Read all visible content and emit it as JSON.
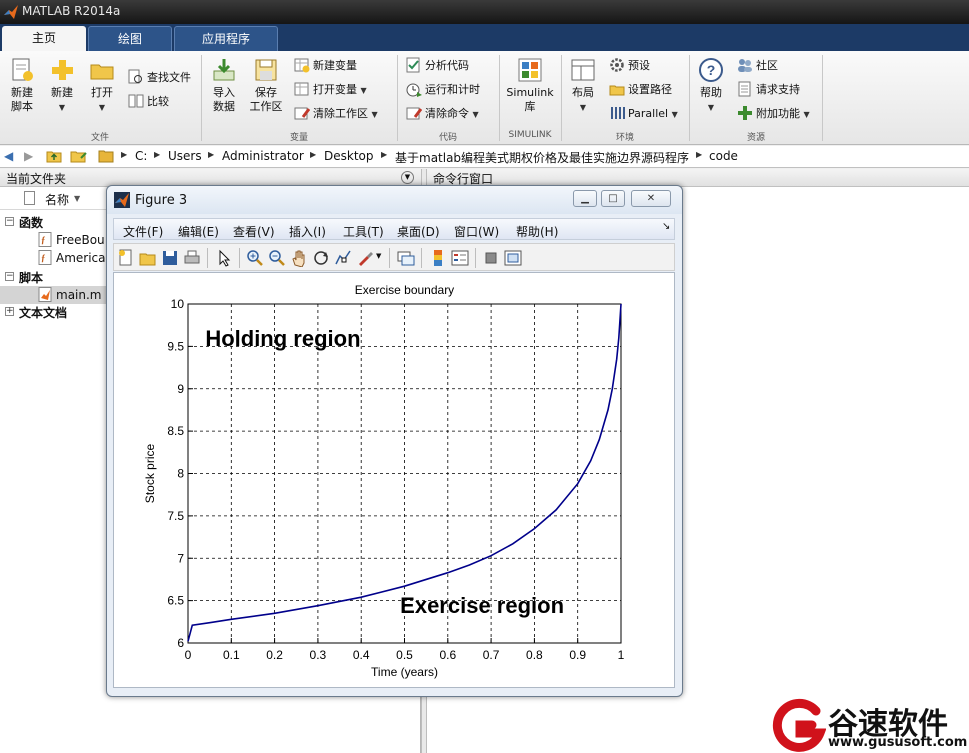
{
  "app": {
    "title": "MATLAB R2014a"
  },
  "tabs": [
    {
      "label": "主页",
      "active": true
    },
    {
      "label": "绘图",
      "active": false
    },
    {
      "label": "应用程序",
      "active": false
    }
  ],
  "ribbon": {
    "file_group": {
      "label": "文件",
      "new_script": "新建\n脚本",
      "new": "新建",
      "open": "打开",
      "find_files": "查找文件",
      "compare": "比较"
    },
    "variable_group": {
      "label": "变量",
      "import_data": "导入\n数据",
      "save_workspace": "保存\n工作区",
      "new_variable": "新建变量",
      "open_variable": "打开变量",
      "clear_workspace": "清除工作区"
    },
    "code_group": {
      "label": "代码",
      "analyze_code": "分析代码",
      "run_and_time": "运行和计时",
      "clear_commands": "清除命令"
    },
    "simulink_group": {
      "label": "SIMULINK",
      "simulink_library": "Simulink\n库"
    },
    "environment_group": {
      "label": "环境",
      "layout": "布局",
      "preferences": "预设",
      "set_path": "设置路径",
      "parallel": "Parallel"
    },
    "resources_group": {
      "label": "资源",
      "help": "帮助",
      "community": "社区",
      "request_support": "请求支持",
      "addons": "附加功能"
    }
  },
  "address": {
    "crumbs": [
      "C:",
      "Users",
      "Administrator",
      "Desktop",
      "基于matlab编程美式期权价格及最佳实施边界源码程序",
      "code"
    ]
  },
  "current_folder": {
    "title": "当前文件夹",
    "column_name": "名称",
    "groups": [
      {
        "label": "函数",
        "items": [
          "FreeBou",
          "Americar"
        ]
      },
      {
        "label": "脚本",
        "items": [
          "main.m"
        ]
      },
      {
        "label": "文本文档",
        "items": []
      }
    ]
  },
  "command_window": {
    "title": "命令行窗口"
  },
  "figure": {
    "title": "Figure 3",
    "menus": [
      "文件(F)",
      "编辑(E)",
      "查看(V)",
      "插入(I)",
      "工具(T)",
      "桌面(D)",
      "窗口(W)",
      "帮助(H)"
    ]
  },
  "chart_data": {
    "type": "line",
    "title": "Exercise boundary",
    "xlabel": "Time (years)",
    "ylabel": "Stock price",
    "xlim": [
      0,
      1
    ],
    "ylim": [
      6,
      10
    ],
    "xticks": [
      "0",
      "0.1",
      "0.2",
      "0.3",
      "0.4",
      "0.5",
      "0.6",
      "0.7",
      "0.8",
      "0.9",
      "1"
    ],
    "yticks": [
      "6",
      "6.5",
      "7",
      "7.5",
      "8",
      "8.5",
      "9",
      "9.5",
      "10"
    ],
    "grid": true,
    "annotations": [
      {
        "text": "Holding region",
        "x": 0.04,
        "y": 9.6
      },
      {
        "text": "Exercise region",
        "x": 0.49,
        "y": 6.45
      }
    ],
    "series": [
      {
        "color": "#00008b",
        "x": [
          0,
          0.01,
          0.05,
          0.1,
          0.2,
          0.3,
          0.4,
          0.5,
          0.6,
          0.65,
          0.7,
          0.75,
          0.8,
          0.85,
          0.9,
          0.93,
          0.95,
          0.97,
          0.98,
          0.99,
          0.995,
          1.0
        ],
        "y": [
          6.02,
          6.21,
          6.24,
          6.28,
          6.35,
          6.44,
          6.54,
          6.67,
          6.83,
          6.92,
          7.03,
          7.17,
          7.35,
          7.57,
          7.88,
          8.15,
          8.4,
          8.75,
          9.0,
          9.35,
          9.6,
          10.0
        ]
      }
    ]
  },
  "watermark": {
    "name": "谷速软件",
    "url": "www.gususoft.com"
  },
  "colors": {
    "tab_bar": "#1c3a66",
    "line": "#00008b",
    "titlebar": "#1e1e1e"
  }
}
